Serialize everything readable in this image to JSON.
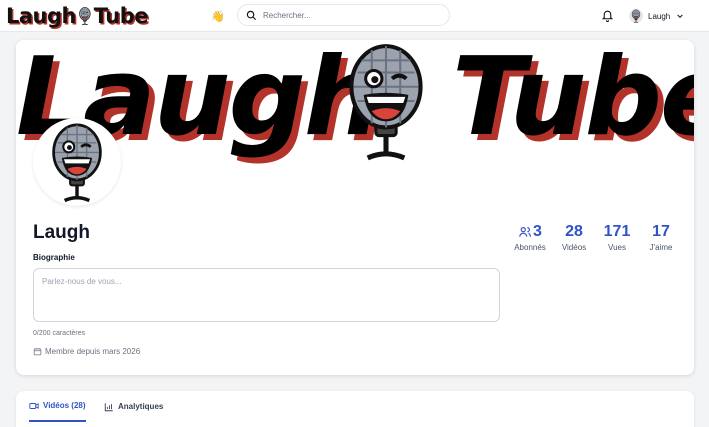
{
  "header": {
    "logo_text_left": "Laugh",
    "logo_text_right": "Tube",
    "search_placeholder": "Rechercher...",
    "user_name": "Laugh"
  },
  "profile": {
    "banner_text_left": "Laugh",
    "banner_text_right": "Tube",
    "name": "Laugh",
    "bio_label": "Biographie",
    "bio_placeholder": "Parlez-nous de vous...",
    "bio_value": "",
    "char_counter": "0/200 caractères",
    "member_since": "Membre depuis mars 2026",
    "stats": [
      {
        "value": "3",
        "label": "Abonnés",
        "icon": "users-icon"
      },
      {
        "value": "28",
        "label": "Vidéos"
      },
      {
        "value": "171",
        "label": "Vues"
      },
      {
        "value": "17",
        "label": "J'aime"
      }
    ]
  },
  "tabs": [
    {
      "label": "Vidéos (28)",
      "icon": "video-icon",
      "active": true
    },
    {
      "label": "Analytiques",
      "icon": "chart-icon",
      "active": false
    }
  ],
  "colors": {
    "accent": "#2f54c8",
    "logo_shadow": "#b3332b",
    "background": "#f3f4f6"
  }
}
